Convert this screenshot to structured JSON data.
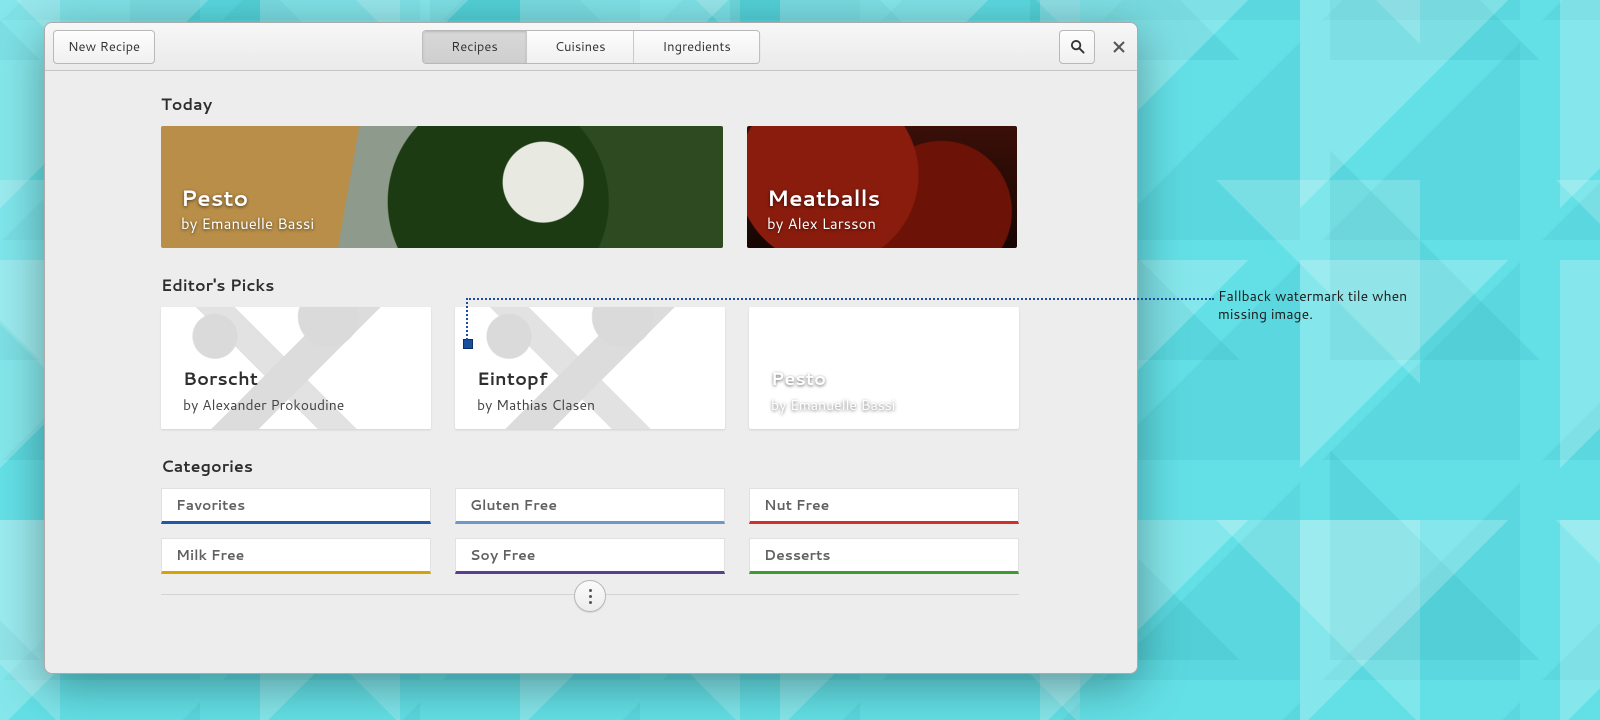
{
  "header": {
    "new_recipe": "New Recipe",
    "tabs": {
      "recipes": "Recipes",
      "cuisines": "Cuisines",
      "ingredients": "Ingredients"
    }
  },
  "sections": {
    "today": "Today",
    "editors_picks": "Editor's Picks",
    "categories": "Categories"
  },
  "today": [
    {
      "title": "Pesto",
      "author": "by Emanuelle Bassi"
    },
    {
      "title": "Meatballs",
      "author": "by Alex Larsson"
    }
  ],
  "picks": [
    {
      "title": "Borscht",
      "author": "by Alexander Prokoudine"
    },
    {
      "title": "Eintopf",
      "author": "by Mathias Clasen"
    },
    {
      "title": "Pesto",
      "author": "by Emanuelle Bassi"
    }
  ],
  "categories": [
    {
      "label": "Favorites",
      "color": "#1f5aa6"
    },
    {
      "label": "Gluten Free",
      "color": "#6f98c9"
    },
    {
      "label": "Nut Free",
      "color": "#d22f2f"
    },
    {
      "label": "Milk Free",
      "color": "#d6a400"
    },
    {
      "label": "Soy Free",
      "color": "#5b3f8f"
    },
    {
      "label": "Desserts",
      "color": "#3f9b2f"
    }
  ],
  "annotation": "Fallback watermark tile when missing image."
}
